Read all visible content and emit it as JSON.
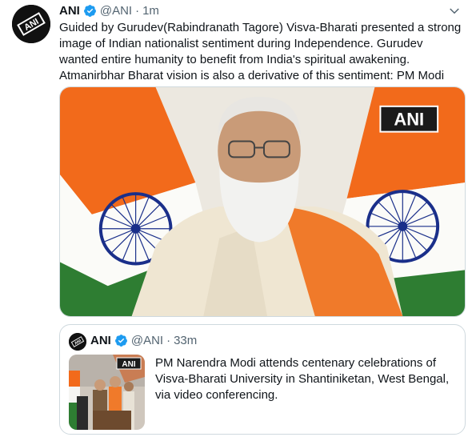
{
  "tweet": {
    "author_name": "ANI",
    "handle": "@ANI",
    "separator": "·",
    "time": "1m",
    "text": "Guided by Gurudev(Rabindranath Tagore) Visva-Bharati presented a strong image of Indian nationalist sentiment during Independence. Gurudev wanted entire humanity to benefit from India's spiritual awakening. Atmanirbhar Bharat vision is also a derivative of this sentiment: PM Modi",
    "media_watermark": "ANI",
    "avatar_text": "ANI"
  },
  "quoted_tweet": {
    "author_name": "ANI",
    "handle": "@ANI",
    "separator": "·",
    "time": "33m",
    "text": "PM Narendra Modi attends centenary celebrations of Visva-Bharati University in Shantiniketan, West Bengal, via video conferencing.",
    "thumb_watermark": "ANI"
  },
  "colors": {
    "verified": "#1d9bf0",
    "secondary_text": "#536471",
    "border": "#cfd9de",
    "saffron": "#f26a1b",
    "flag_green": "#2e7d32",
    "chakra": "#1a2f8a"
  },
  "icons": {
    "more": "chevron-down-icon",
    "verified": "verified-badge-icon"
  }
}
